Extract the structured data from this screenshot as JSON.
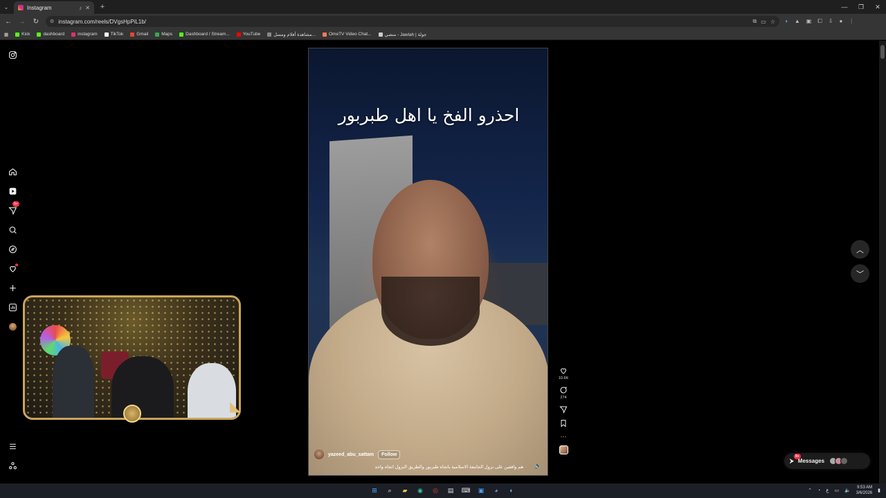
{
  "browser": {
    "tab_title": "Instagram",
    "new_tab": "+",
    "url": "instagram.com/reels/DVgsHpPiL1b/",
    "bookmarks": [
      "Kick",
      "dashboard",
      "instagram",
      "TikTok",
      "Gmail",
      "Maps",
      "Dashboard / Stream...",
      "YouTube",
      "مشاهدة أفلام ومسل...",
      "OmeTV Video Chat...",
      "منصي - Jawlah | جولة"
    ]
  },
  "sidebar": {
    "notifications_badge": "9+"
  },
  "reel": {
    "caption_overlay": "احذرو الفخ يا اهل طبربور",
    "username": "yazeed_abu_sattam",
    "follow_label": "Follow",
    "description": "هم واقفين على نزول الجامعة الاسلامية باتجاه طبربور والطريق النزول اتجاه واحد",
    "likes": "10.6K",
    "comments": "274",
    "more": "···"
  },
  "messages": {
    "label": "Messages",
    "badge": "9+"
  },
  "taskbar": {
    "lang": "ع",
    "time": "9:53 AM",
    "date": "3/6/2026"
  },
  "colors": {
    "accent": "#ff3040",
    "frame": "#c9a55a"
  }
}
